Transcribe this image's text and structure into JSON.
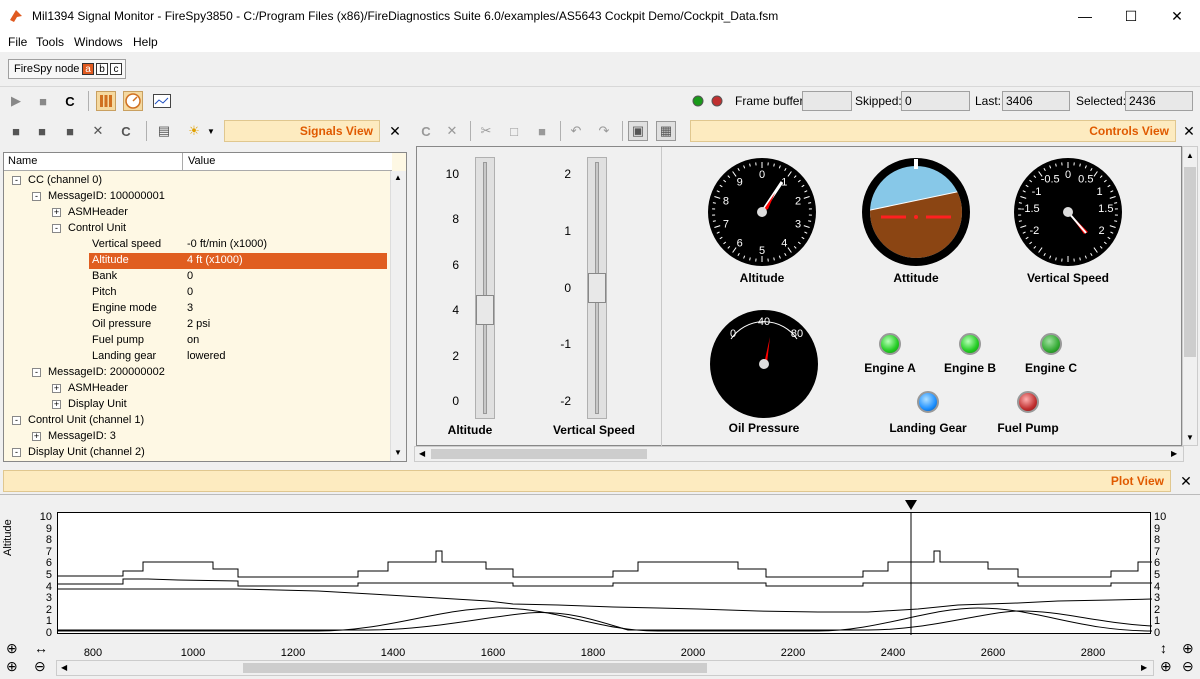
{
  "window": {
    "title": "Mil1394 Signal Monitor - FireSpy3850  - C:/Program Files (x86)/FireDiagnostics Suite 6.0/examples/AS5643 Cockpit Demo/Cockpit_Data.fsm"
  },
  "menu": [
    "File",
    "Tools",
    "Windows",
    "Help"
  ],
  "node": {
    "label": "FireSpy node",
    "boxes": [
      "a",
      "b",
      "c"
    ]
  },
  "status": {
    "frame_buffer_label": "Frame buffer:",
    "frame_buffer_value": "",
    "skipped_label": "Skipped:",
    "skipped_value": "0",
    "last_label": "Last:",
    "last_value": "3406",
    "selected_label": "Selected:",
    "selected_value": "2436"
  },
  "signals_view": {
    "title": "Signals View",
    "columns": [
      "Name",
      "Value"
    ],
    "rows": [
      {
        "name": "CC (channel 0)",
        "value": "",
        "level": 0,
        "exp": "-"
      },
      {
        "name": "MessageID: 100000001",
        "value": "",
        "level": 1,
        "exp": "-"
      },
      {
        "name": "ASMHeader",
        "value": "",
        "level": 2,
        "exp": "+"
      },
      {
        "name": "Control Unit",
        "value": "",
        "level": 2,
        "exp": "-"
      },
      {
        "name": "Vertical speed",
        "value": "-0 ft/min (x1000)",
        "level": 3,
        "exp": ""
      },
      {
        "name": "Altitude",
        "value": "4 ft (x1000)",
        "level": 3,
        "exp": "",
        "selected": true
      },
      {
        "name": "Bank",
        "value": "0",
        "level": 3,
        "exp": ""
      },
      {
        "name": "Pitch",
        "value": "0",
        "level": 3,
        "exp": ""
      },
      {
        "name": "Engine mode",
        "value": "3",
        "level": 3,
        "exp": ""
      },
      {
        "name": "Oil pressure",
        "value": "2 psi",
        "level": 3,
        "exp": ""
      },
      {
        "name": "Fuel pump",
        "value": "on",
        "level": 3,
        "exp": ""
      },
      {
        "name": "Landing gear",
        "value": "lowered",
        "level": 3,
        "exp": ""
      },
      {
        "name": "MessageID: 200000002",
        "value": "",
        "level": 1,
        "exp": "-"
      },
      {
        "name": "ASMHeader",
        "value": "",
        "level": 2,
        "exp": "+"
      },
      {
        "name": "Display Unit",
        "value": "",
        "level": 2,
        "exp": "+"
      },
      {
        "name": "Control Unit (channel 1)",
        "value": "",
        "level": 0,
        "exp": "-"
      },
      {
        "name": "MessageID: 3",
        "value": "",
        "level": 1,
        "exp": "+"
      },
      {
        "name": "Display Unit (channel 2)",
        "value": "",
        "level": 0,
        "exp": "-"
      }
    ]
  },
  "controls_view": {
    "title": "Controls View",
    "slider_altitude": {
      "label": "Altitude",
      "ticks": [
        "10",
        "8",
        "6",
        "4",
        "2",
        "0"
      ],
      "value": 4,
      "min": 0,
      "max": 10
    },
    "slider_vspeed": {
      "label": "Vertical Speed",
      "ticks": [
        "2",
        "1",
        "0",
        "-1",
        "-2"
      ],
      "value": 0,
      "min": -2,
      "max": 2
    },
    "altimeter": {
      "label": "Altitude",
      "numbers": [
        "0",
        "1",
        "2",
        "3",
        "4",
        "5",
        "6",
        "7",
        "8",
        "9"
      ]
    },
    "attitude": {
      "label": "Attitude"
    },
    "vsi": {
      "label": "Vertical Speed",
      "numbers": [
        "0",
        "0.5",
        "1",
        "1.5",
        "2",
        "-2",
        "-1.5",
        "-1",
        "-0.5"
      ]
    },
    "oil": {
      "label": "Oil Pressure",
      "numbers": [
        "0",
        "40",
        "80"
      ]
    },
    "lights": [
      {
        "label": "Engine A",
        "color": "#22cc22"
      },
      {
        "label": "Engine B",
        "color": "#22cc22"
      },
      {
        "label": "Engine C",
        "color": "#33aa33"
      },
      {
        "label": "Landing Gear",
        "color": "#1e90ff"
      },
      {
        "label": "Fuel Pump",
        "color": "#c03030"
      }
    ]
  },
  "plot_view": {
    "title": "Plot View",
    "ylabel": "Altitude",
    "yticks": [
      "10",
      "9",
      "8",
      "7",
      "6",
      "5",
      "4",
      "3",
      "2",
      "1",
      "0"
    ],
    "xticks": [
      "800",
      "1000",
      "1200",
      "1400",
      "1600",
      "1800",
      "2000",
      "2200",
      "2400",
      "2600",
      "2800"
    ]
  }
}
